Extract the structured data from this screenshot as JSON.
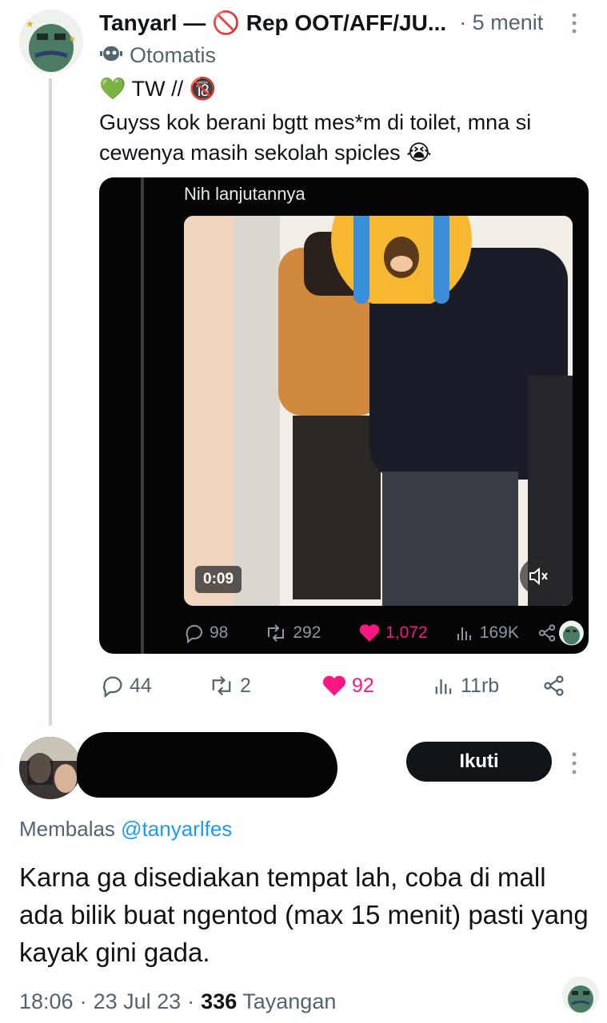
{
  "tweet": {
    "author_name": "Tanyarl — 🚫 Rep OOT/AFF/JU...",
    "time": "· 5 menit",
    "automated_label": "Otomatis",
    "tw_line": "💚 TW // 🔞",
    "body": "Guyss kok berani bgtt mes*m di toilet, mna si cewenya masih sekolah spicles 😭",
    "video": {
      "caption": "Nih lanjutannya",
      "duration": "0:09",
      "stats": {
        "replies": "98",
        "reposts": "292",
        "likes": "1,072",
        "views": "169K"
      }
    },
    "actions": {
      "replies": "44",
      "reposts": "2",
      "likes": "92",
      "views": "11rb"
    }
  },
  "reply": {
    "follow_label": "Ikuti",
    "replying_prefix": "Membalas",
    "replying_handle": "@tanyarlfes",
    "body": "Karna ga disediakan tempat lah, coba di mall ada bilik buat ngentod (max 15 menit) pasti yang kayak gini gada.",
    "time": "18:06",
    "date": "23 Jul 23",
    "views_count": "336",
    "views_label": "Tayangan"
  },
  "colors": {
    "like": "#f91880",
    "accent": "#1d9bf0",
    "muted": "#536471"
  }
}
